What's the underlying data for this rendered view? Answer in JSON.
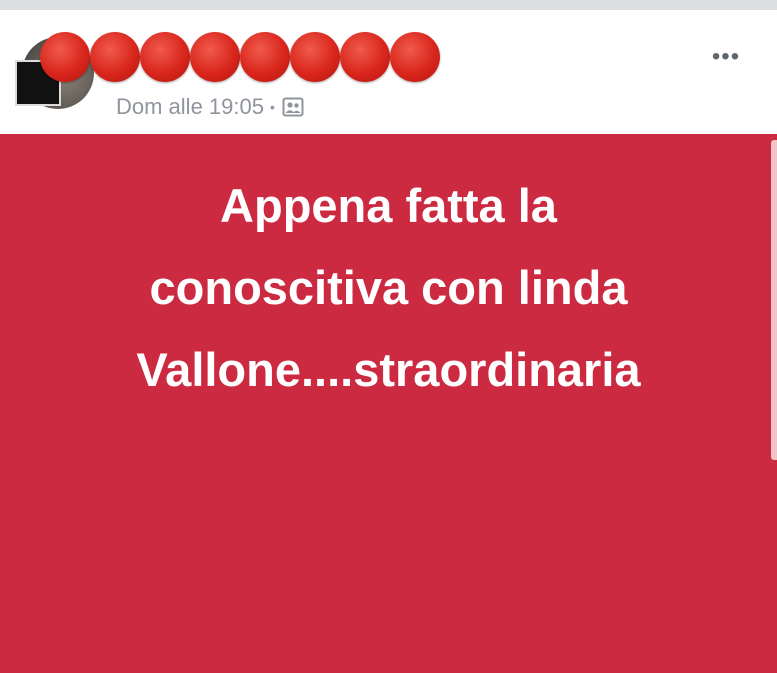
{
  "post": {
    "timestamp": "Dom alle 19:05",
    "separator": "•",
    "audience_icon": "friends-icon",
    "more_label": "•••",
    "status_lines": [
      "Appena fatta la",
      "conoscitiva con linda",
      "Vallone....straordinaria"
    ],
    "background_color": "#cc2a41",
    "text_color": "#ffffff"
  }
}
